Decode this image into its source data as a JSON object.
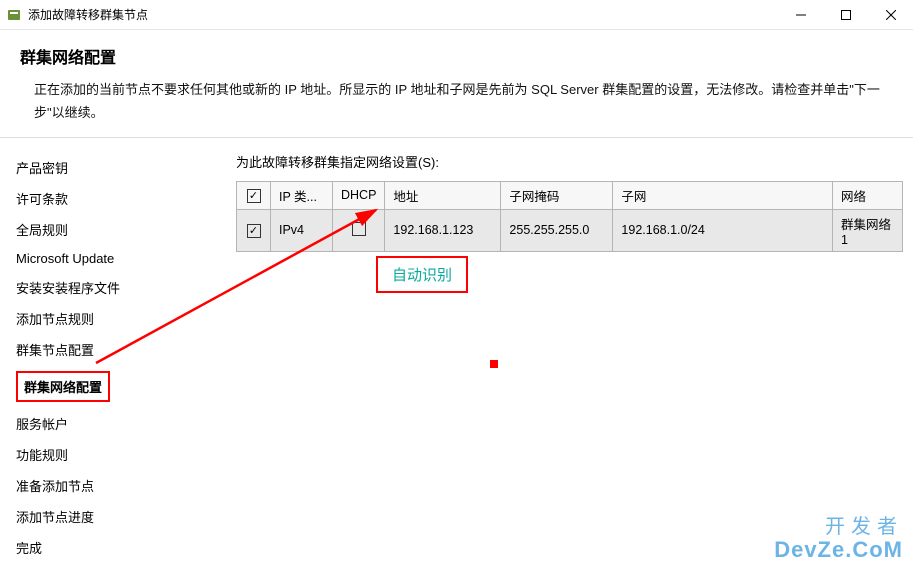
{
  "window": {
    "title": "添加故障转移群集节点"
  },
  "header": {
    "title": "群集网络配置",
    "desc": "正在添加的当前节点不要求任何其他或新的 IP 地址。所显示的 IP 地址和子网是先前为 SQL Server 群集配置的设置，无法修改。请检查并单击\"下一步\"以继续。"
  },
  "sidebar": {
    "items": [
      {
        "label": "产品密钥"
      },
      {
        "label": "许可条款"
      },
      {
        "label": "全局规则"
      },
      {
        "label": "Microsoft Update"
      },
      {
        "label": "安装安装程序文件"
      },
      {
        "label": "添加节点规则"
      },
      {
        "label": "群集节点配置"
      },
      {
        "label": "群集网络配置",
        "active": true
      },
      {
        "label": "服务帐户"
      },
      {
        "label": "功能规则"
      },
      {
        "label": "准备添加节点"
      },
      {
        "label": "添加节点进度"
      },
      {
        "label": "完成"
      }
    ]
  },
  "main": {
    "instr": "为此故障转移群集指定网络设置(S):",
    "cols": {
      "check": "",
      "iptype": "IP 类...",
      "dhcp": "DHCP",
      "addr": "地址",
      "mask": "子网掩码",
      "subnet": "子网",
      "net": "网络"
    },
    "row": {
      "checked": true,
      "iptype": "IPv4",
      "dhcp": false,
      "addr": "192.168.1.123",
      "mask": "255.255.255.0",
      "subnet": "192.168.1.0/24",
      "net": "群集网络 1"
    }
  },
  "annot": {
    "auto": "自动识别"
  },
  "watermark": {
    "l1": "开发者",
    "l2": "DevZe.CoM"
  }
}
